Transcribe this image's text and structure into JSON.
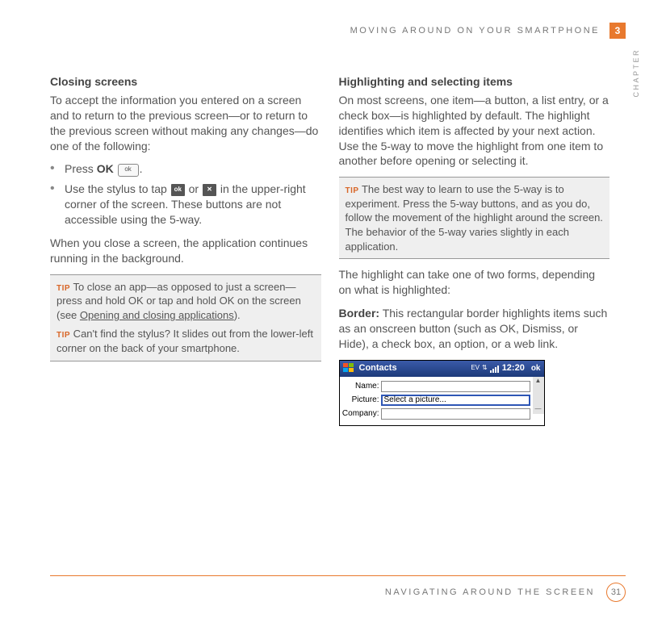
{
  "header": {
    "running_head": "MOVING AROUND ON YOUR SMARTPHONE",
    "chapter_number": "3",
    "chapter_label": "CHAPTER"
  },
  "left": {
    "heading": "Closing screens",
    "intro": "To accept the information you entered on a screen and to return to the previous screen—or to return to the previous screen without making any changes—do one of the following:",
    "bullet1_prefix": "Press ",
    "bullet1_bold": "OK",
    "bullet1_suffix": " ",
    "bullet1_after": ".",
    "ok_icon_label": "ok",
    "bullet2_prefix": "Use the stylus to tap ",
    "bullet2_mid": " or ",
    "bullet2_suffix": " in the upper-right corner of the screen. These buttons are not accessible using the 5-way.",
    "ok_small_label": "ok",
    "x_small_label": "✕",
    "para2": "When you close a screen, the application continues running in the background.",
    "tip1_label": "TIP",
    "tip1_text_before": " To close an app—as opposed to just a screen—press and hold OK or tap and hold OK on the screen (see ",
    "tip1_link": "Opening and closing applications",
    "tip1_text_after": ").",
    "tip2_label": "TIP",
    "tip2_text": " Can't find the stylus? It slides out from the lower-left corner on the back of your smartphone."
  },
  "right": {
    "heading": "Highlighting and selecting items",
    "intro": "On most screens, one item—a button, a list entry, or a check box—is highlighted by default. The highlight identifies which item is affected by your next action. Use the 5-way to move the highlight from one item to another before opening or selecting it.",
    "tip_label": "TIP",
    "tip_text": " The best way to learn to use the 5-way is to experiment. Press the 5-way buttons, and as you do, follow the movement of the highlight around the screen. The behavior of the 5-way varies slightly in each application.",
    "para2": "The highlight can take one of two forms, depending on what is highlighted:",
    "border_label": "Border:",
    "border_text": " This rectangular border highlights items such as an onscreen button (such as OK, Dismiss, or Hide), a check box, an option, or a web link."
  },
  "device": {
    "title": "Contacts",
    "ev": "EV",
    "time": "12:20",
    "ok": "ok",
    "row1_label": "Name:",
    "row2_label": "Picture:",
    "row2_value": "Select a picture...",
    "row3_label": "Company:"
  },
  "footer": {
    "title": "NAVIGATING AROUND THE SCREEN",
    "page": "31"
  }
}
